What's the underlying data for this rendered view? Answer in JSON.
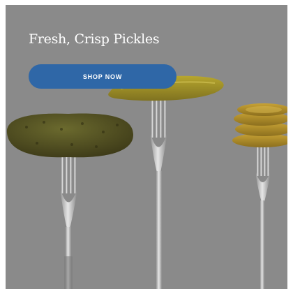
{
  "hero": {
    "headline": "Fresh, Crisp Pickles",
    "cta_label": "SHOP NOW"
  },
  "colors": {
    "background": "#8a8a8a",
    "button": "#2f67a7",
    "text": "#ffffff"
  },
  "icons": [
    "fork-icon",
    "pickle-icon",
    "pickle-spear-icon",
    "pickle-chips-icon"
  ]
}
